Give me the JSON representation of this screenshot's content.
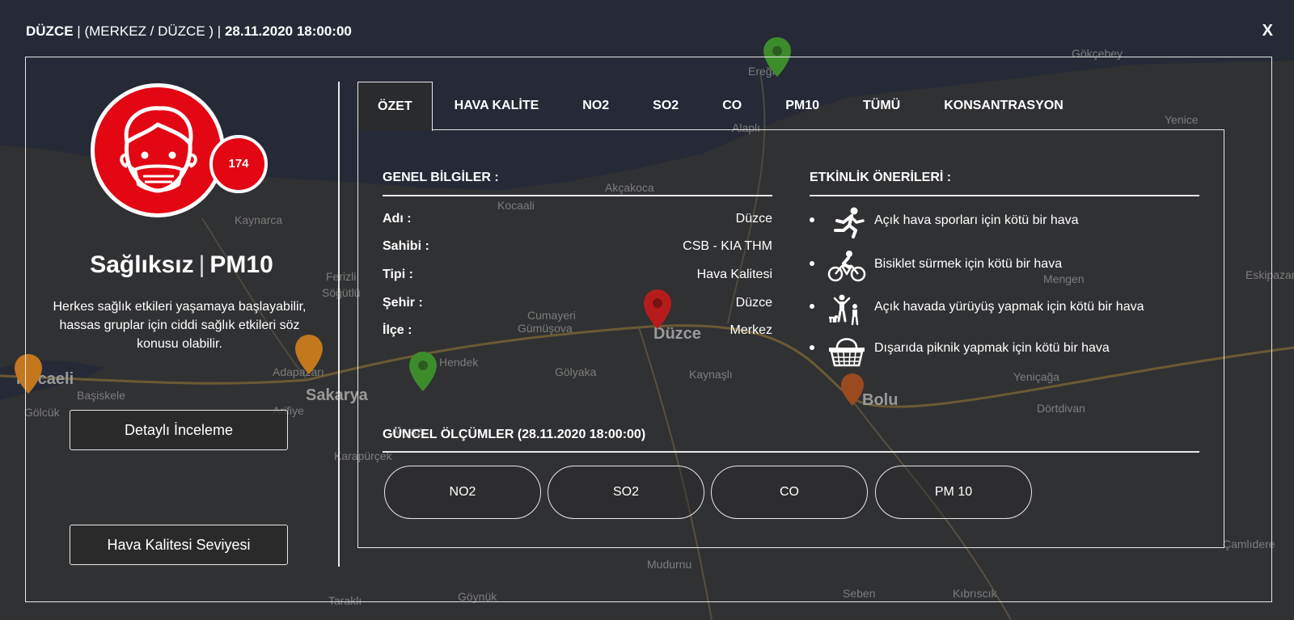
{
  "header": {
    "city": "DÜZCE",
    "sep1": "|",
    "location": "(MERKEZ / DÜZCE )",
    "sep2": "|",
    "datetime": "28.11.2020 18:00:00",
    "close_label": "X"
  },
  "map": {
    "labels": [
      "Ereğli",
      "Alaplı",
      "Akçakoca",
      "Kocaali",
      "Kaynarca",
      "Ferizli",
      "Söğütlü",
      "Cumayeri",
      "Gümüşova",
      "Düzce",
      "Hendek",
      "Gölyaka",
      "Kaynaşlı",
      "Adapazarı",
      "Sakarya",
      "Arifiye",
      "Kocaeli",
      "Başiskele",
      "Gölcük",
      "Akyazı",
      "Karapürçek",
      "Bolu",
      "Yeniçağa",
      "Dörtdivan",
      "Mengen",
      "Eskipazar",
      "Yenice",
      "Gökçebey",
      "Çamlıdere",
      "Mudurnu",
      "Seben",
      "Kıbrıscık",
      "Göynük",
      "Taraklı"
    ],
    "colors": {
      "marker_red": "#b71c1c",
      "marker_green": "#3d8c2c",
      "marker_orange": "#c4781e"
    }
  },
  "left": {
    "aqi_value": "174",
    "status": "Sağlıksız",
    "status_sep": "|",
    "pollutant": "PM10",
    "description": "Herkes sağlık etkileri yaşamaya başlayabilir, hassas gruplar için ciddi sağlık etkileri söz konusu olabilir.",
    "detail_button": "Detaylı İnceleme",
    "level_button": "Hava Kalitesi Seviyesi",
    "colors": {
      "status_red": "#e30613"
    }
  },
  "tabs": [
    {
      "label": "ÖZET"
    },
    {
      "label": "HAVA KALİTE"
    },
    {
      "label": "NO2"
    },
    {
      "label": "SO2"
    },
    {
      "label": "CO"
    },
    {
      "label": "PM10"
    },
    {
      "label": "TÜMÜ"
    },
    {
      "label": "KONSANTRASYON"
    }
  ],
  "general": {
    "title": "GENEL BİLGİLER :",
    "rows": [
      {
        "key": "Adı :",
        "value": "Düzce"
      },
      {
        "key": "Sahibi :",
        "value": "CSB - KIA THM"
      },
      {
        "key": "Tipi :",
        "value": "Hava Kalitesi"
      },
      {
        "key": "Şehir :",
        "value": "Düzce"
      },
      {
        "key": "İlçe :",
        "value": "Merkez"
      }
    ]
  },
  "activities": {
    "title": "ETKİNLİK ÖNERİLERİ :",
    "items": [
      {
        "icon": "running-icon",
        "text": "Açık hava sporları için kötü bir hava"
      },
      {
        "icon": "bicycle-icon",
        "text": "Bisiklet sürmek için kötü bir hava"
      },
      {
        "icon": "family-walking-icon",
        "text": "Açık havada yürüyüş yapmak için kötü bir hava"
      },
      {
        "icon": "picnic-basket-icon",
        "text": "Dışarıda piknik yapmak için kötü bir hava"
      }
    ]
  },
  "current": {
    "title": "GÜNCEL ÖLÇÜMLER (28.11.2020 18:00:00)",
    "buttons": [
      {
        "label": "NO2"
      },
      {
        "label": "SO2"
      },
      {
        "label": "CO"
      },
      {
        "label": "PM 10"
      }
    ]
  }
}
